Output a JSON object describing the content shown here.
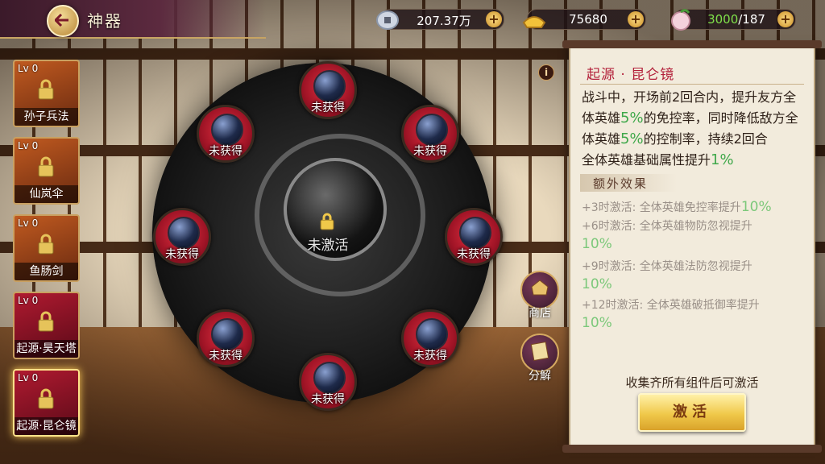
{
  "header": {
    "title": "神器"
  },
  "resources": [
    {
      "icon": "silver-coin-icon",
      "value": "207.37万"
    },
    {
      "icon": "gold-ingot-icon",
      "value": "75680"
    },
    {
      "icon": "peach-icon",
      "value": "3000",
      "max": "/187"
    }
  ],
  "artifacts": [
    {
      "level": "Lv 0",
      "name": "孙子兵法"
    },
    {
      "level": "Lv 0",
      "name": "仙岚伞"
    },
    {
      "level": "Lv 0",
      "name": "鱼肠剑"
    },
    {
      "level": "Lv 0",
      "name": "起源·昊天塔"
    },
    {
      "level": "Lv 0",
      "name": "起源·昆仑镜"
    }
  ],
  "center": {
    "status": "未激活"
  },
  "components": [
    {
      "label": "未获得"
    },
    {
      "label": "未获得"
    },
    {
      "label": "未获得"
    },
    {
      "label": "未获得"
    },
    {
      "label": "未获得"
    },
    {
      "label": "未获得"
    },
    {
      "label": "未获得"
    },
    {
      "label": "未获得"
    }
  ],
  "side_buttons": {
    "shop": "商店",
    "decompose": "分解"
  },
  "panel": {
    "title": "起源 · 昆仑镜",
    "desc_1a": "战斗中，开场前2回合内，提升友方全体英雄",
    "desc_1b": "5%",
    "desc_1c": "的免控率，同时降低敌方全体英雄",
    "desc_1d": "5%",
    "desc_1e": "的控制率，持续2回合",
    "desc_2a": "全体英雄基础属性提升",
    "desc_2b": "1%",
    "extra_title": "额外效果",
    "bonuses": [
      {
        "text": "+3时激活: 全体英雄免控率提升",
        "pct": "10%"
      },
      {
        "text": "+6时激活: 全体英雄物防忽视提升",
        "pct": "10%"
      },
      {
        "text": "+9时激活: 全体英雄法防忽视提升",
        "pct": "10%"
      },
      {
        "text": "+12时激活: 全体英雄破抵御率提升",
        "pct": "10%"
      }
    ],
    "note": "收集齐所有组件后可激活",
    "activate_label": "激活"
  }
}
